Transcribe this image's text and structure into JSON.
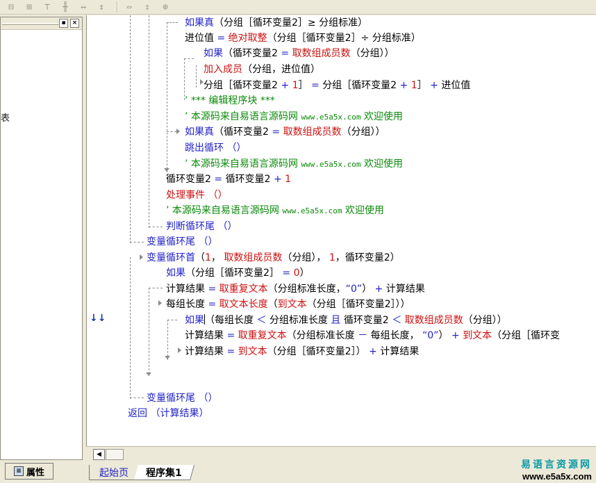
{
  "toolbar": {
    "icons": [
      "align-left-icon",
      "align-center-icon",
      "align-top-icon",
      "align-middle-icon",
      "space-horizontal-icon",
      "space-vertical-icon",
      "width-equal-icon",
      "height-equal-icon",
      "center-icon"
    ]
  },
  "left_panel": {
    "min_btn": "▪",
    "close_btn": "×",
    "fragment": "表"
  },
  "properties_tab": "属性",
  "gutter": {
    "mark1": "≫",
    "mark2": "↓↓+"
  },
  "code": {
    "l1a": "如果真",
    "l1b": "（分组［循环变量2］≥ 分组标准）",
    "l2a": "进位值",
    "l2b": "=",
    "l2c": "绝对取整",
    "l2d": "（分组［循环变量2］÷ 分组标准）",
    "l3a": "如果",
    "l3b": "（循环变量2",
    "l3c": "=",
    "l3d": "取数组成员数",
    "l3e": "（分组））",
    "l4a": "加入成员",
    "l4b": "（分组，进位值）",
    "l5a": "分组［循环变量2",
    "l5b": "+",
    "l5c": "1",
    "l5d": "］",
    "l5e": "=",
    "l5f": "分组［循环变量2",
    "l5g": "+",
    "l5h": "1",
    "l5i": "］",
    "l5j": "+",
    "l5k": "进位值",
    "l6": "’ *** 编辑程序块 ***",
    "l7a": "’ 本源码来自易语言源码网",
    "l7b": "www.e5a5x.com",
    "l7c": "欢迎使用",
    "l8a": "如果真",
    "l8b": "（循环变量2",
    "l8c": "=",
    "l8d": "取数组成员数",
    "l8e": "（分组））",
    "l9": "跳出循环 （）",
    "l10a": "’ 本源码来自易语言源码网",
    "l10b": "www.e5a5x.com",
    "l10c": "欢迎使用",
    "l11a": "循环变量2",
    "l11b": "=",
    "l11c": "循环变量2",
    "l11d": "+",
    "l11e": "1",
    "l12": "处理事件 （）",
    "l13a": "’ 本源码来自易语言源码网",
    "l13b": "www.e5a5x.com",
    "l13c": "欢迎使用",
    "l14": "判断循环尾 （）",
    "l15": "变量循环尾 （）",
    "l16a": "变量循环首",
    "l16b": "（",
    "l16c": "1",
    "l16d": "，",
    "l16e": "取数组成员数",
    "l16f": "（分组），",
    "l16g": "1",
    "l16h": "，循环变量2）",
    "l17a": "如果",
    "l17b": "（分组［循环变量2］",
    "l17c": "=",
    "l17d": "0",
    "l17e": "）",
    "l18a": "计算结果",
    "l18b": "=",
    "l18c": "取重复文本",
    "l18d": "（分组标准长度，",
    "l18e": "“0”",
    "l18f": "）",
    "l18g": "+",
    "l18h": "计算结果",
    "l19a": "每组长度",
    "l19b": "=",
    "l19c": "取文本长度",
    "l19d": "（",
    "l19e": "到文本",
    "l19f": "（分组［循环变量2］））",
    "l20a": "如果",
    "l20b": "（每组长度",
    "l20c": "＜",
    "l20d": "分组标准长度",
    "l20e": "且",
    "l20f": "循环变量2",
    "l20g": "＜",
    "l20h": "取数组成员数",
    "l20i": "（分组））",
    "l21a": "计算结果",
    "l21b": "=",
    "l21c": "取重复文本",
    "l21d": "（分组标准长度",
    "l21e": "－",
    "l21f": "每组长度，",
    "l21g": "“0”",
    "l21h": "）",
    "l21i": "+",
    "l21j": "到文本",
    "l21k": "（分组［循环变",
    "l22a": "计算结果",
    "l22b": "=",
    "l22c": "到文本",
    "l22d": "（分组［循环变量2］）",
    "l22e": "+",
    "l22f": "计算结果",
    "l23": "变量循环尾 （）",
    "l24": "返回 （计算结果）"
  },
  "tabs": {
    "start": "起始页",
    "program": "程序集1"
  },
  "logo": {
    "cn": "易语言资源网",
    "url": "www.e5a5x.com"
  }
}
